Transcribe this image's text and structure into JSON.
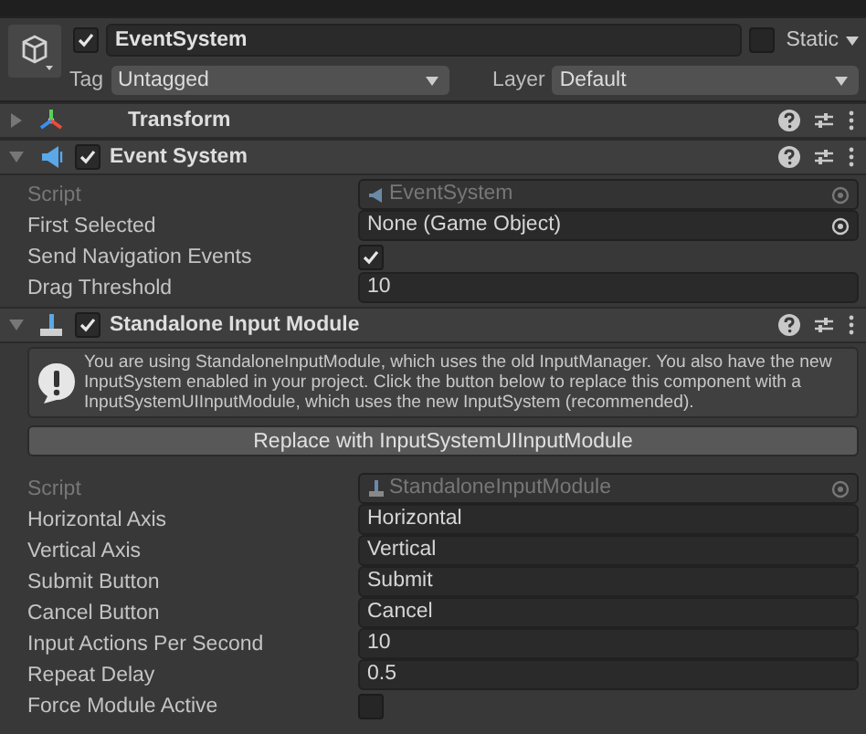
{
  "game_object": {
    "active": true,
    "name": "EventSystem",
    "static_label": "Static",
    "static": false,
    "tag_label": "Tag",
    "tag": "Untagged",
    "layer_label": "Layer",
    "layer": "Default"
  },
  "components": [
    {
      "kind": "transform",
      "title": "Transform",
      "expanded": false
    },
    {
      "kind": "event_system",
      "title": "Event System",
      "expanded": true,
      "enabled": true,
      "properties": [
        {
          "kind": "script",
          "label": "Script",
          "value": "EventSystem"
        },
        {
          "kind": "object",
          "label": "First Selected",
          "value": "None (Game Object)"
        },
        {
          "kind": "toggle",
          "label": "Send Navigation Events",
          "checked": true
        },
        {
          "kind": "text",
          "label": "Drag Threshold",
          "value": "10"
        }
      ]
    },
    {
      "kind": "input_module",
      "title": "Standalone Input Module",
      "expanded": true,
      "enabled": true,
      "help": "You are using StandaloneInputModule, which uses the old InputManager. You also have the new InputSystem enabled in your project. Click the button below to replace this component with a InputSystemUIInputModule, which uses the new InputSystem (recommended).",
      "button": "Replace with InputSystemUIInputModule",
      "properties": [
        {
          "kind": "script",
          "label": "Script",
          "value": "StandaloneInputModule"
        },
        {
          "kind": "text",
          "label": "Horizontal Axis",
          "value": "Horizontal"
        },
        {
          "kind": "text",
          "label": "Vertical Axis",
          "value": "Vertical"
        },
        {
          "kind": "text",
          "label": "Submit Button",
          "value": "Submit"
        },
        {
          "kind": "text",
          "label": "Cancel Button",
          "value": "Cancel"
        },
        {
          "kind": "text",
          "label": "Input Actions Per Second",
          "value": "10"
        },
        {
          "kind": "text",
          "label": "Repeat Delay",
          "value": "0.5"
        },
        {
          "kind": "toggle",
          "label": "Force Module Active",
          "checked": false
        }
      ]
    }
  ]
}
